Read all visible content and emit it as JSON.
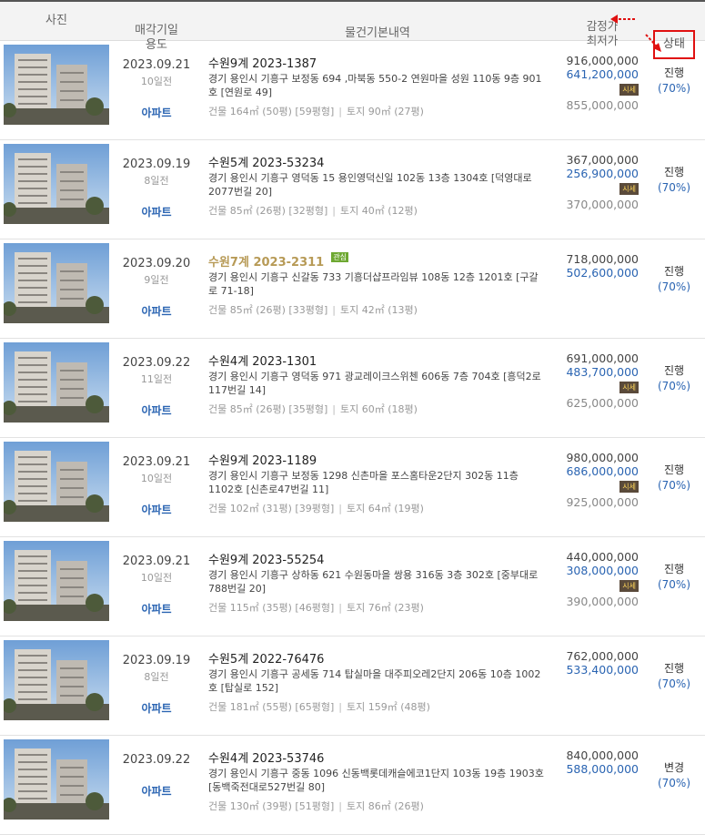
{
  "header": {
    "photo": "사진",
    "date_line1": "매각기일",
    "date_line2": "용도",
    "info": "물건기본내역",
    "price_line1": "감정가",
    "price_line2": "최저가",
    "status": "상태"
  },
  "accent_color": "#2a64b2",
  "highlight_border": "#e01010",
  "rows": [
    {
      "date": "2023.09.21",
      "ago": "10일전",
      "use": "아파트",
      "case": "수원9계 2023-1387",
      "highlight": false,
      "addr": "경기 용인시 기흥구 보정동 694 ,마북동 550-2 연원마을 성원 110동 9층 901호 [연원로 49]",
      "area": "건물 164㎡ (50평) [59평형]",
      "land": "토지 90㎡ (27평)",
      "appraisal": "916,000,000",
      "minimum": "641,200,000",
      "sise": "시세",
      "sale": "855,000,000",
      "status": "진행",
      "pct": "(70%)"
    },
    {
      "date": "2023.09.19",
      "ago": "8일전",
      "use": "아파트",
      "case": "수원5계 2023-53234",
      "highlight": false,
      "addr": "경기 용인시 기흥구 영덕동 15 용인영덕신일 102동 13층 1304호 [덕영대로2077번길 20]",
      "area": "건물 85㎡ (26평) [32평형]",
      "land": "토지 40㎡ (12평)",
      "appraisal": "367,000,000",
      "minimum": "256,900,000",
      "sise": "시세",
      "sale": "370,000,000",
      "status": "진행",
      "pct": "(70%)"
    },
    {
      "date": "2023.09.20",
      "ago": "9일전",
      "use": "아파트",
      "case": "수원7계 2023-2311",
      "highlight": true,
      "badge": "관심",
      "addr": "경기 용인시 기흥구 신갈동 733 기흥더샵프라임뷰 108동 12층 1201호 [구갈로 71-18]",
      "area": "건물 85㎡ (26평) [33평형]",
      "land": "토지 42㎡ (13평)",
      "appraisal": "718,000,000",
      "minimum": "502,600,000",
      "sise": "",
      "sale": "",
      "status": "진행",
      "pct": "(70%)"
    },
    {
      "date": "2023.09.22",
      "ago": "11일전",
      "use": "아파트",
      "case": "수원4계 2023-1301",
      "highlight": false,
      "addr": "경기 용인시 기흥구 영덕동 971 광교레이크스위첸 606동 7층 704호 [흥덕2로117번길 14]",
      "area": "건물 85㎡ (26평) [35평형]",
      "land": "토지 60㎡ (18평)",
      "appraisal": "691,000,000",
      "minimum": "483,700,000",
      "sise": "시세",
      "sale": "625,000,000",
      "status": "진행",
      "pct": "(70%)"
    },
    {
      "date": "2023.09.21",
      "ago": "10일전",
      "use": "아파트",
      "case": "수원9계 2023-1189",
      "highlight": false,
      "addr": "경기 용인시 기흥구 보정동 1298 신촌마을 포스홈타운2단지 302동 11층 1102호 [신촌로47번길 11]",
      "area": "건물 102㎡ (31평) [39평형]",
      "land": "토지 64㎡ (19평)",
      "appraisal": "980,000,000",
      "minimum": "686,000,000",
      "sise": "시세",
      "sale": "925,000,000",
      "status": "진행",
      "pct": "(70%)"
    },
    {
      "date": "2023.09.21",
      "ago": "10일전",
      "use": "아파트",
      "case": "수원9계 2023-55254",
      "highlight": false,
      "addr": "경기 용인시 기흥구 상하동 621 수원동마을 쌍용 316동 3층 302호 [중부대로788번길 20]",
      "area": "건물 115㎡ (35평) [46평형]",
      "land": "토지 76㎡ (23평)",
      "appraisal": "440,000,000",
      "minimum": "308,000,000",
      "sise": "시세",
      "sale": "390,000,000",
      "status": "진행",
      "pct": "(70%)"
    },
    {
      "date": "2023.09.19",
      "ago": "8일전",
      "use": "아파트",
      "case": "수원5계 2022-76476",
      "highlight": false,
      "addr": "경기 용인시 기흥구 공세동 714 탑실마을 대주피오레2단지 206동 10층 1002호 [탑실로 152]",
      "area": "건물 181㎡ (55평) [65평형]",
      "land": "토지 159㎡ (48평)",
      "appraisal": "762,000,000",
      "minimum": "533,400,000",
      "sise": "",
      "sale": "",
      "status": "진행",
      "pct": "(70%)"
    },
    {
      "date": "2023.09.22",
      "ago": "",
      "use": "아파트",
      "case": "수원4계 2023-53746",
      "highlight": false,
      "addr": "경기 용인시 기흥구 중동 1096 신동백롯데캐슬에코1단지 103동 19층 1903호 [동백죽전대로527번길 80]",
      "area": "건물 130㎡ (39평) [51평형]",
      "land": "토지 86㎡ (26평)",
      "appraisal": "840,000,000",
      "minimum": "588,000,000",
      "sise": "",
      "sale": "",
      "status": "변경",
      "pct": "(70%)"
    }
  ]
}
